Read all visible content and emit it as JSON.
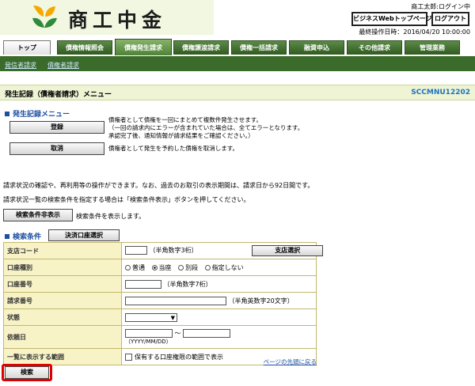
{
  "header": {
    "logo_text": "商工中金",
    "user_status": "商工太郎:ログイン中",
    "top_button": "ビジネスWebトップページへ",
    "logout_button": "ログアウト",
    "last_operation": "最終操作日時：2016/04/20 10:00:00"
  },
  "tabs": [
    {
      "label": "トップ"
    },
    {
      "label": "債権情報照会"
    },
    {
      "label": "債権発生請求"
    },
    {
      "label": "債権譲渡請求"
    },
    {
      "label": "債権一括請求"
    },
    {
      "label": "融資申込"
    },
    {
      "label": "その他請求"
    },
    {
      "label": "管理業務"
    }
  ],
  "subnav": {
    "link1": "発信者請求",
    "link2": "債権者請求"
  },
  "page": {
    "title": "発生記録（債権者請求）メニュー",
    "screen_code": "SCCMNU12202"
  },
  "menu": {
    "heading": "発生記録メニュー",
    "register_button": "登録",
    "register_desc1": "債権者として債権を一回にまとめて複数件発生させます。",
    "register_desc2": "（一回の請求内にエラーが含まれていた場合は、全てエラーとなります。",
    "register_desc3": "承認完了後、通知情報が請求結果をご確認ください。）",
    "cancel_button": "取消",
    "cancel_desc": "債権者として発生を予約した債権を取消します。"
  },
  "info": {
    "line1": "請求状況の確認や、再利用等の操作ができます。なお、過去のお取引の表示期間は、請求日から92日間です。",
    "line2": "請求状況一覧の検索条件を指定する場合は「検索条件表示」ボタンを押してください。",
    "toggle_button": "検索条件非表示",
    "toggle_desc": "検索条件を表示します。"
  },
  "search": {
    "heading": "検索条件",
    "account_button": "決済口座選択",
    "branch_label": "支店コード",
    "branch_hint": "（半角数字3桁）",
    "branch_button": "支店選択",
    "acct_type_label": "口座種別",
    "acct_type_options": [
      "普通",
      "当座",
      "別段",
      "指定しない"
    ],
    "acct_num_label": "口座番号",
    "acct_num_hint": "（半角数字7桁）",
    "request_num_label": "請求番号",
    "request_num_hint": "（半角英数字20文字）",
    "status_label": "状態",
    "request_date_label": "依頼日",
    "date_sep": "～",
    "date_format": "（YYYY/MM/DD）",
    "scope_label": "一覧に表示する範囲",
    "scope_option": "保有する口座権限の範囲で表示",
    "page_top_link": "ページの先頭に戻る",
    "search_button": "検索"
  }
}
